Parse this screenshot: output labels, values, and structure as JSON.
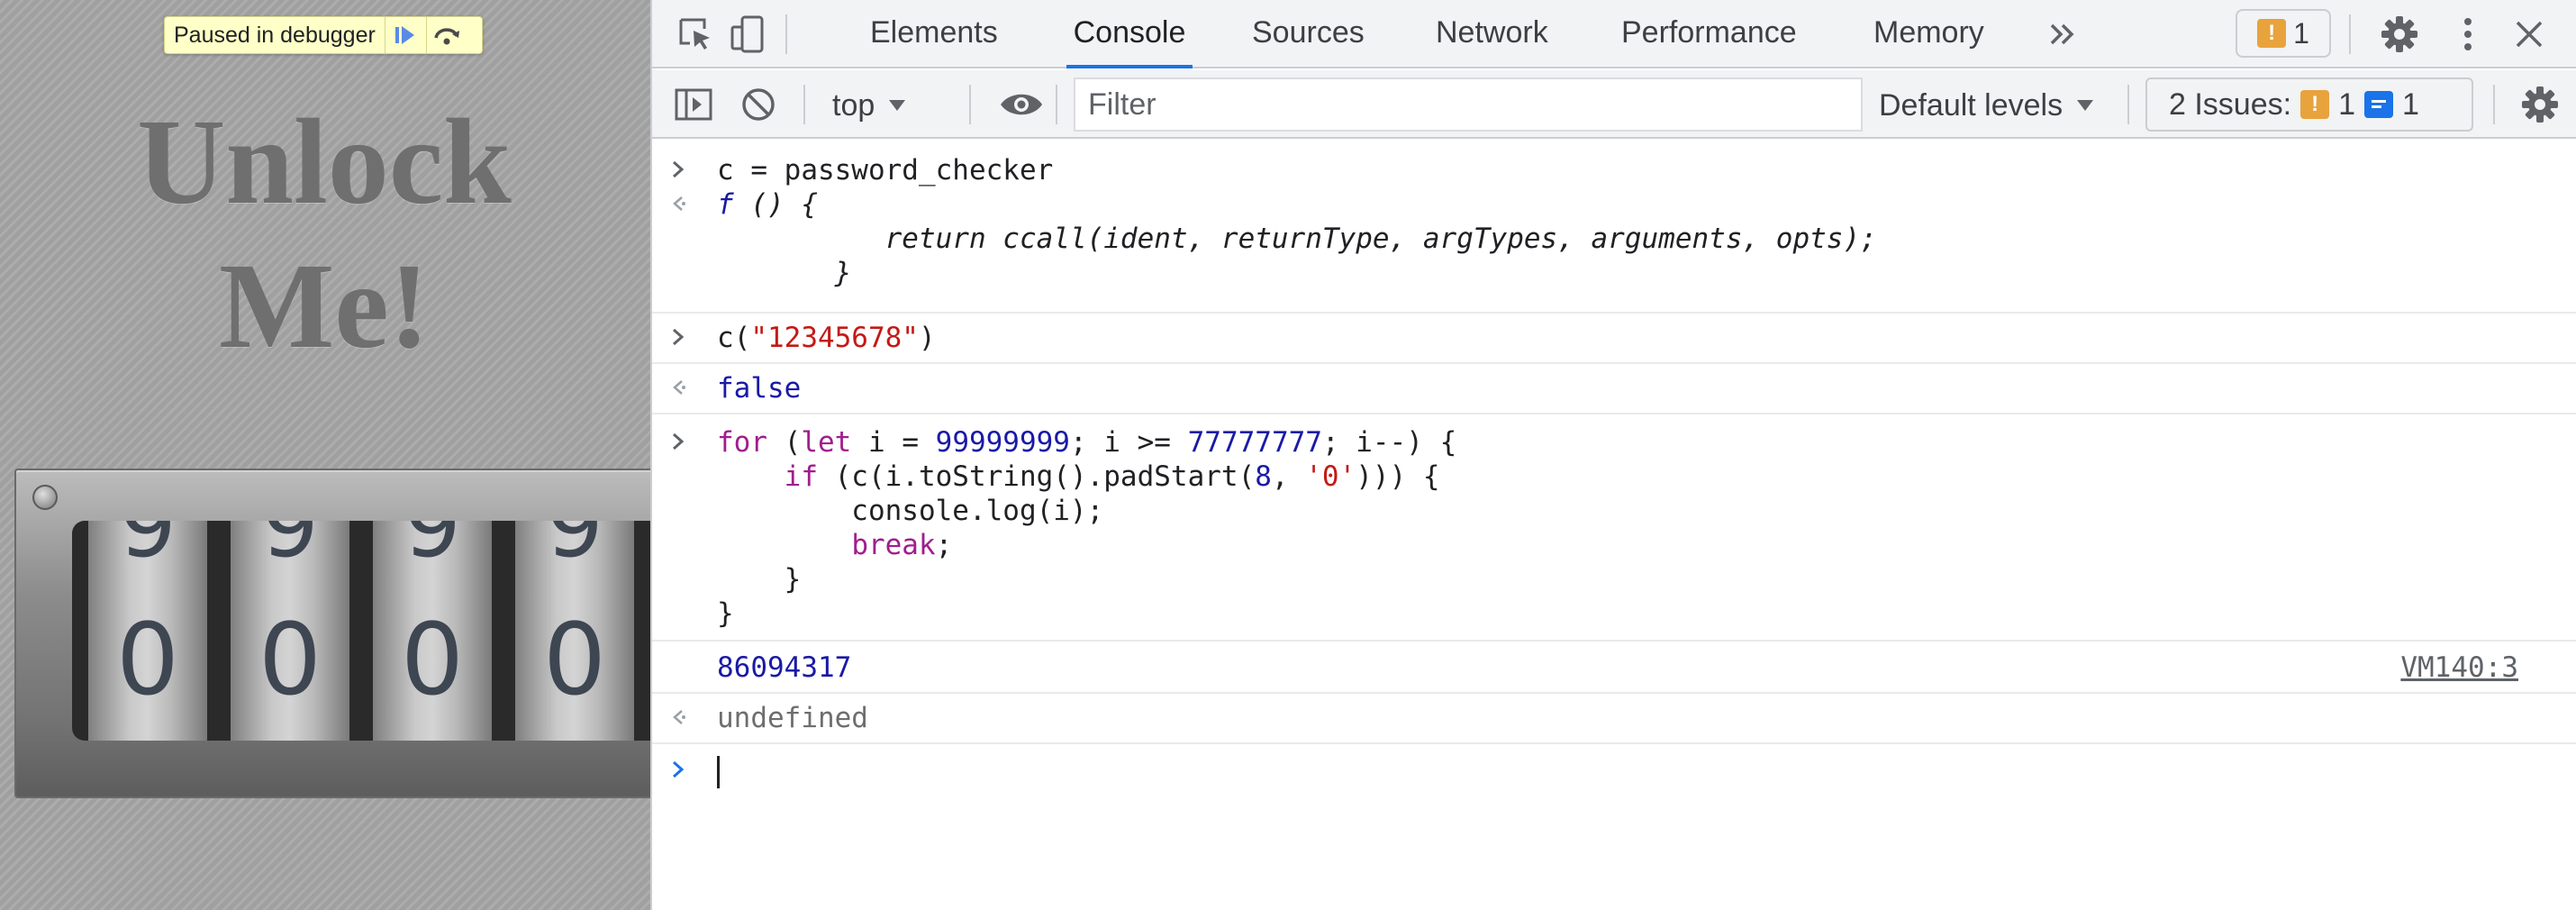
{
  "page": {
    "debugger_banner": {
      "text": "Paused in debugger",
      "resume_icon": "resume-icon",
      "step_over_icon": "step-over-icon"
    },
    "title_line1": "Unlock",
    "title_line2": "Me!",
    "lock": {
      "dials": [
        {
          "prev": "9",
          "current": "0"
        },
        {
          "prev": "9",
          "current": "0"
        },
        {
          "prev": "9",
          "current": "0"
        },
        {
          "prev": "9",
          "current": "0"
        }
      ]
    }
  },
  "devtools": {
    "tabs": [
      "Elements",
      "Console",
      "Sources",
      "Network",
      "Performance",
      "Memory"
    ],
    "active_tab": "Console",
    "more_tabs_icon": "chevron-double-right-icon",
    "issues_badge_count": "1",
    "toolbar": {
      "context": "top",
      "filter_placeholder": "Filter",
      "filter_value": "",
      "levels": "Default levels",
      "issues_label": "2 Issues:",
      "issues_warnings": "1",
      "issues_info": "1"
    },
    "colors": {
      "accent": "#1a73e8",
      "keyword": "#a11d8f",
      "number": "#1a1aa6",
      "string": "#c41a16",
      "warning": "#e8a33d"
    },
    "console": {
      "entry1_input": "c = password_checker",
      "entry1_output": {
        "line1_f": "f",
        "line1_rest": " () {",
        "line2": "          return ccall(ident, returnType, argTypes, arguments, opts);",
        "line3": "       }"
      },
      "entry2_input": {
        "fn": "c(",
        "arg": "\"12345678\"",
        "close": ")"
      },
      "entry2_output": "false",
      "entry3_input": {
        "l1": {
          "kw_for": "for",
          "p1": " (",
          "kw_let": "let",
          "p2": " i = ",
          "n1": "99999999",
          "p3": "; i >= ",
          "n2": "77777777",
          "p4": "; i--) {"
        },
        "l2": {
          "indent": "    ",
          "kw_if": "if",
          "p1": " (c(i.toString().padStart(",
          "n": "8",
          "p2": ", ",
          "s": "'0'",
          "p3": "))) {"
        },
        "l3": "        console.log(i);",
        "l4": {
          "indent": "        ",
          "kw_break": "break",
          "tail": ";"
        },
        "l5": "    }",
        "l6": "}"
      },
      "entry3_log": "86094317",
      "entry3_log_source": "VM140:3",
      "entry3_return": "undefined",
      "prompt_value": ""
    }
  }
}
